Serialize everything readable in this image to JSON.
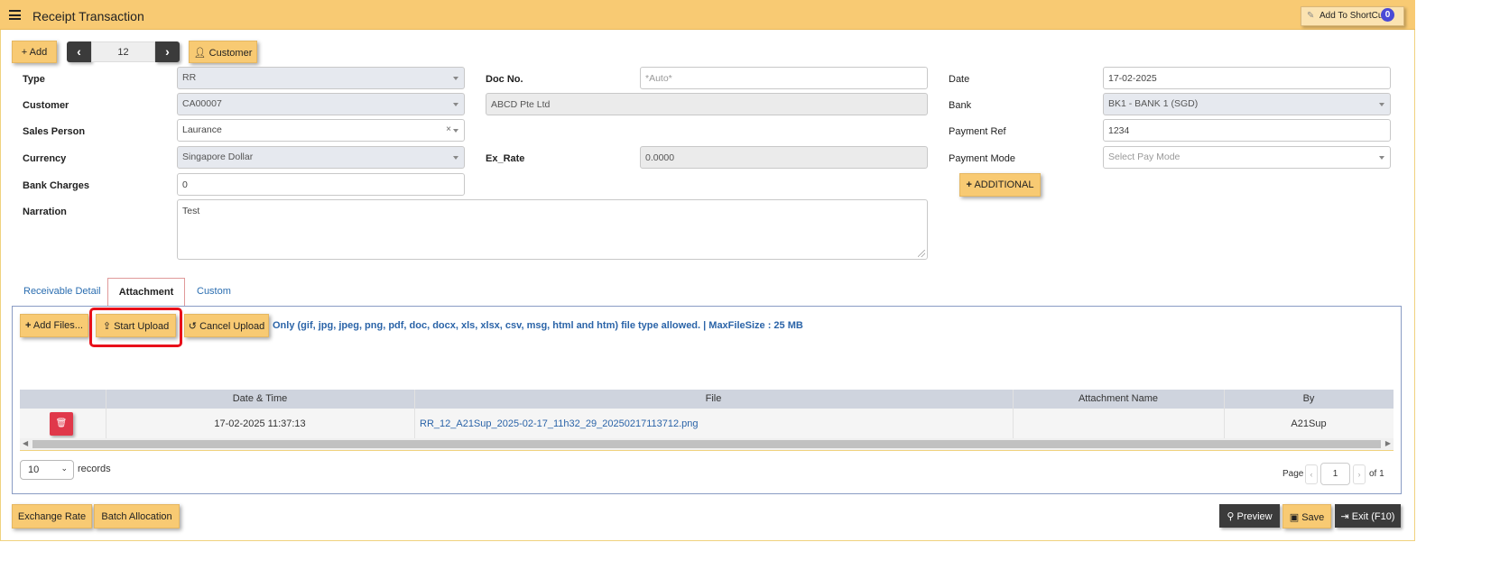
{
  "header": {
    "title": "Receipt Transaction",
    "shortcut_label": "Add To ShortCut",
    "shortcut_count": "0"
  },
  "toolbar": {
    "add_label": "+ Add",
    "doc_number": "12",
    "customer_label": "Customer"
  },
  "form": {
    "type": {
      "label": "Type",
      "value": "RR"
    },
    "customer": {
      "label": "Customer",
      "value": "CA00007",
      "name": "ABCD Pte Ltd"
    },
    "sales_person": {
      "label": "Sales Person",
      "value": "Laurance"
    },
    "currency": {
      "label": "Currency",
      "value": "Singapore Dollar"
    },
    "bank_charges": {
      "label": "Bank Charges",
      "value": "0"
    },
    "narration": {
      "label": "Narration",
      "value": "Test"
    },
    "doc_no": {
      "label": "Doc No.",
      "placeholder": "*Auto*"
    },
    "ex_rate": {
      "label": "Ex_Rate",
      "value": "0.0000"
    },
    "date": {
      "label": "Date",
      "value": "17-02-2025"
    },
    "bank": {
      "label": "Bank",
      "value": "BK1 - BANK 1 (SGD)"
    },
    "payment_ref": {
      "label": "Payment Ref",
      "value": "1234"
    },
    "payment_mode": {
      "label": "Payment Mode",
      "placeholder": "Select Pay Mode"
    },
    "additional_label": "ADDITIONAL"
  },
  "tabs": [
    "Receivable Detail",
    "Attachment",
    "Custom"
  ],
  "attachment": {
    "add_files": "Add Files...",
    "start_upload": "Start Upload",
    "cancel_upload": "Cancel Upload",
    "allowed_text": "Only (gif, jpg, jpeg, png, pdf, doc, docx, xls, xlsx, csv, msg, html and htm) file type allowed. | MaxFileSize : 25 MB",
    "columns": [
      "Date & Time",
      "File",
      "Attachment Name",
      "By"
    ],
    "rows": [
      {
        "datetime": "17-02-2025 11:37:13",
        "file": "RR_12_A21Sup_2025-02-17_11h32_29_20250217113712.png",
        "attachment_name": "",
        "by": "A21Sup"
      }
    ],
    "page_size": "10",
    "records_label": "records",
    "page_label": "Page",
    "page_value": "1",
    "of_label": "of 1"
  },
  "footer": {
    "exchange_rate": "Exchange Rate",
    "batch_allocation": "Batch Allocation",
    "preview": "Preview",
    "save": "Save",
    "exit": "Exit (F10)"
  }
}
